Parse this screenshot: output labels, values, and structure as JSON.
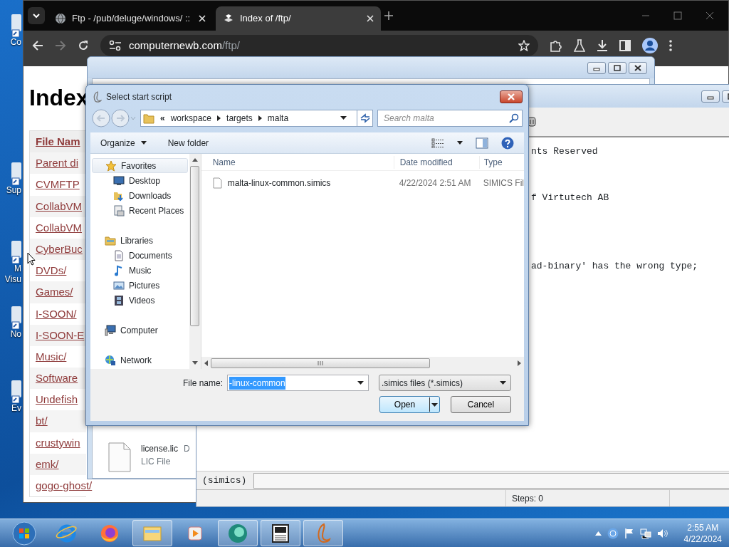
{
  "desktop_icons": [
    {
      "lines": [
        "Co"
      ]
    },
    {
      "lines": [
        "Sup"
      ]
    },
    {
      "lines": [
        "M",
        "Visu"
      ]
    },
    {
      "lines": [
        "No"
      ]
    },
    {
      "lines": [
        "Ev"
      ]
    }
  ],
  "browser": {
    "tabs": [
      {
        "title": "Ftp - /pub/deluge/windows/ ::",
        "selected": false
      },
      {
        "title": "Index of /ftp/",
        "selected": true
      }
    ],
    "address": {
      "host": "computernewb.com",
      "path": "/ftp/"
    },
    "page": {
      "heading": "Index",
      "column_header": "File Nam",
      "links": [
        "Parent di",
        "CVMFTP",
        "CollabVM",
        "CollabVM",
        "CyberBuc",
        "DVDs/",
        "Games/",
        "I-SOON/",
        "I-SOON-E",
        "Music/",
        "Software",
        "Undefish",
        "bt/",
        "crustywin",
        "emk/",
        "gogo-ghost/"
      ]
    }
  },
  "back_window": {
    "files": [
      {
        "name": "license.lic",
        "column_2": "D",
        "type": "LIC File"
      }
    ]
  },
  "console": {
    "lines": [
      "nts Reserved",
      "f Virtutech AB",
      "ad-binary' has the wrong type;"
    ],
    "prompt": "(simics)",
    "status": "Steps: 0"
  },
  "dialog": {
    "title": "Select start script",
    "path_prefix": "«",
    "path": [
      "workspace",
      "targets",
      "malta"
    ],
    "search_placeholder": "Search malta",
    "toolbar": [
      "Organize",
      "New folder"
    ],
    "nav": [
      {
        "label": "Favorites",
        "selected": true,
        "children": [
          {
            "label": "Desktop",
            "selected": false
          },
          {
            "label": "Downloads",
            "selected": false
          },
          {
            "label": "Recent Places",
            "selected": false
          }
        ]
      },
      {
        "label": "Libraries",
        "selected": false,
        "children": [
          {
            "label": "Documents",
            "selected": false
          },
          {
            "label": "Music",
            "selected": false
          },
          {
            "label": "Pictures",
            "selected": false
          },
          {
            "label": "Videos",
            "selected": false
          }
        ]
      },
      {
        "label": "Computer",
        "selected": false
      },
      {
        "label": "Network",
        "selected": false
      }
    ],
    "columns": [
      "Name",
      "Date modified",
      "Type"
    ],
    "files": [
      {
        "name": "malta-linux-common.simics",
        "date": "4/22/2024 2:51 AM",
        "type": "SIMICS Fil"
      }
    ],
    "file_name_label": "File name:",
    "file_name": "-linux-common",
    "file_name_highlighted": true,
    "filter": ".simics files (*.simics)",
    "buttons": [
      "Open",
      "Cancel"
    ]
  },
  "taskbar": {
    "time": "2:55 AM",
    "date": "4/22/2024"
  }
}
